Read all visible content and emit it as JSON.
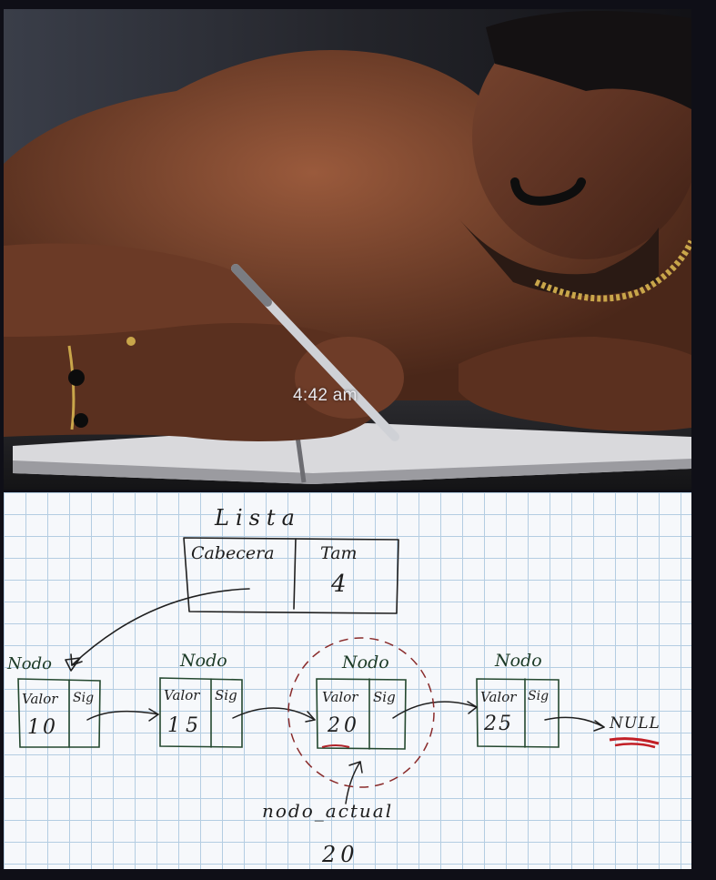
{
  "photo": {
    "timestamp": "4:42 am"
  },
  "diagram": {
    "list_title": "Lista",
    "head_label": "Cabecera",
    "size_label": "Tam",
    "size_value": "4",
    "nodes": [
      {
        "title": "Nodo",
        "valor_label": "Valor",
        "sig_label": "Sig",
        "value": "10"
      },
      {
        "title": "Nodo",
        "valor_label": "Valor",
        "sig_label": "Sig",
        "value": "15"
      },
      {
        "title": "Nodo",
        "valor_label": "Valor",
        "sig_label": "Sig",
        "value": "20"
      },
      {
        "title": "Nodo",
        "valor_label": "Valor",
        "sig_label": "Sig",
        "value": "25"
      }
    ],
    "null_label": "NULL",
    "pointer_label": "nodo_actual",
    "pointer_value": "20"
  }
}
